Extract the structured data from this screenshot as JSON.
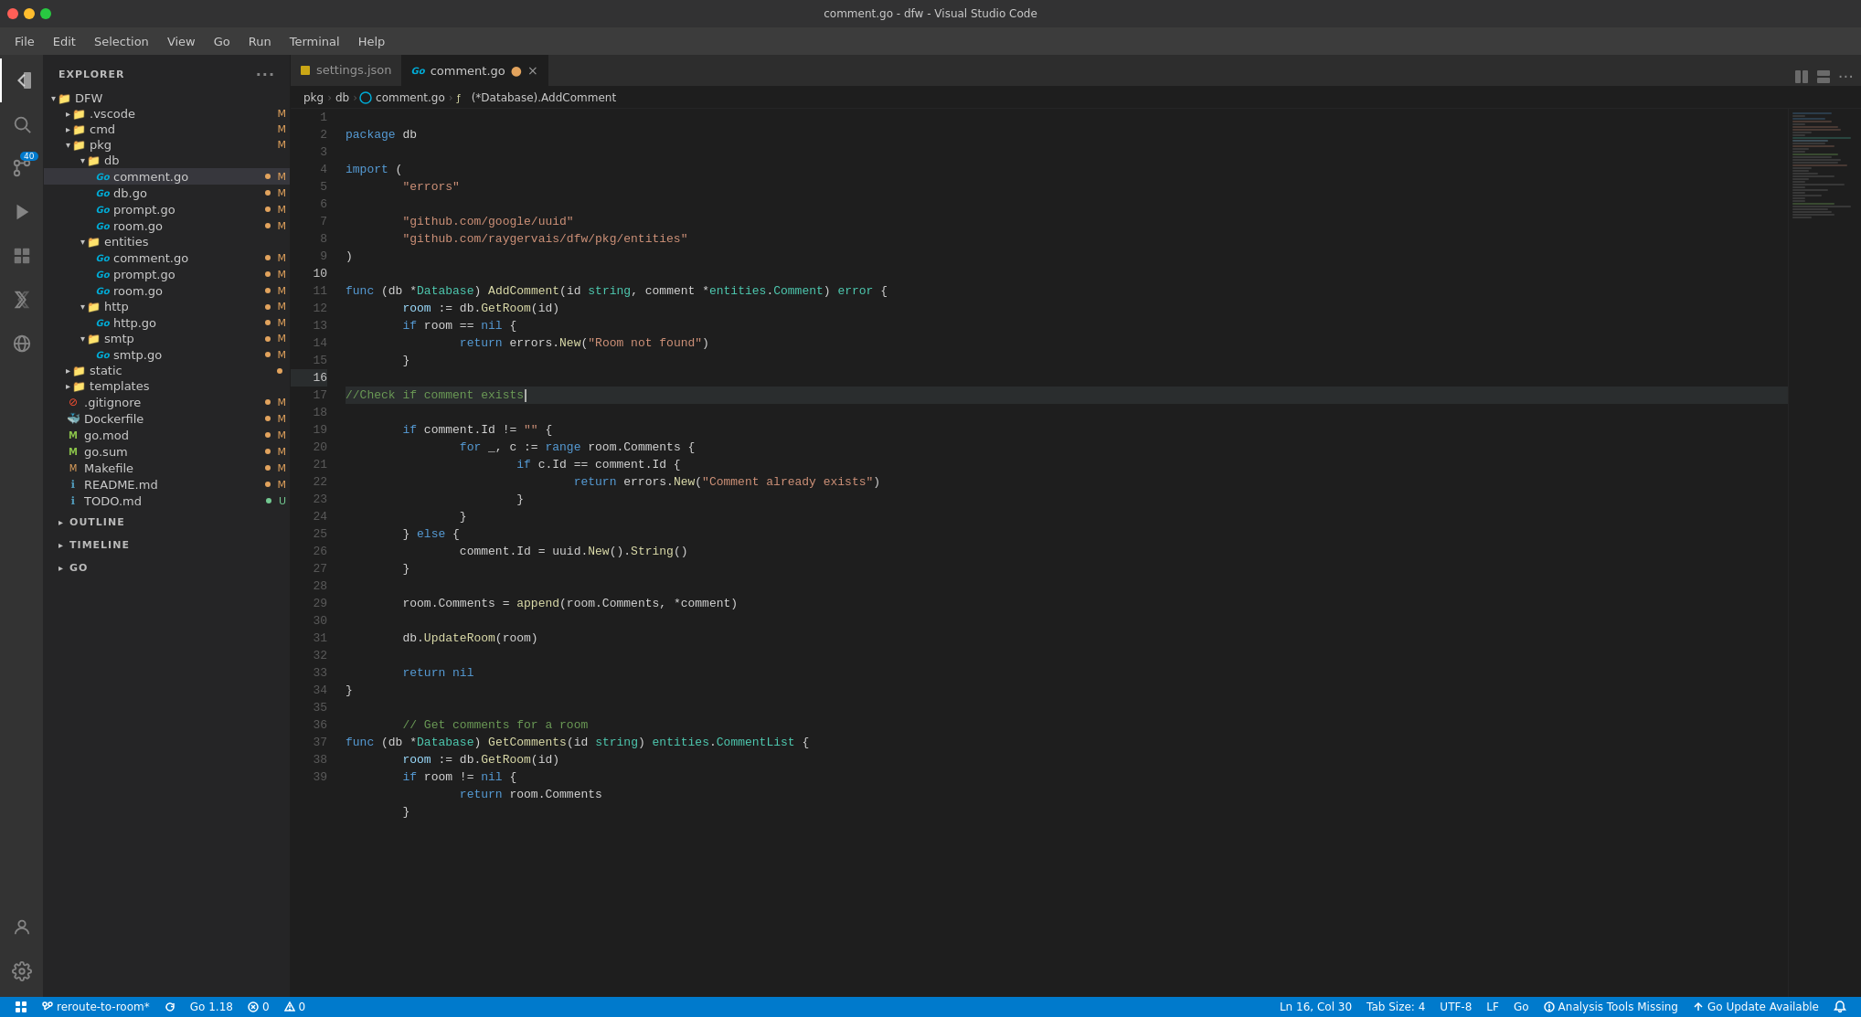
{
  "window": {
    "title": "comment.go - dfw - Visual Studio Code",
    "controls": {
      "close": "×",
      "minimize": "–",
      "maximize": "□"
    }
  },
  "menu": {
    "items": [
      "File",
      "Edit",
      "Selection",
      "View",
      "Go",
      "Run",
      "Terminal",
      "Help"
    ]
  },
  "sidebar": {
    "title": "EXPLORER",
    "root": "DFW",
    "tree": [
      {
        "label": ".vscode",
        "type": "folder",
        "indent": 1,
        "badge": "M",
        "expanded": false
      },
      {
        "label": "cmd",
        "type": "folder",
        "indent": 1,
        "badge": "M",
        "expanded": false
      },
      {
        "label": "pkg",
        "type": "folder",
        "indent": 1,
        "badge": "M",
        "expanded": true
      },
      {
        "label": "db",
        "type": "folder",
        "indent": 2,
        "badge": "",
        "expanded": true
      },
      {
        "label": "comment.go",
        "type": "file-go",
        "indent": 3,
        "badge": "M",
        "active": true
      },
      {
        "label": "db.go",
        "type": "file-go",
        "indent": 3,
        "badge": "M"
      },
      {
        "label": "prompt.go",
        "type": "file-go",
        "indent": 3,
        "badge": "M"
      },
      {
        "label": "room.go",
        "type": "file-go",
        "indent": 3,
        "badge": "M"
      },
      {
        "label": "entities",
        "type": "folder",
        "indent": 2,
        "badge": "",
        "expanded": true
      },
      {
        "label": "comment.go",
        "type": "file-go",
        "indent": 3,
        "badge": "M"
      },
      {
        "label": "prompt.go",
        "type": "file-go",
        "indent": 3,
        "badge": "M"
      },
      {
        "label": "room.go",
        "type": "file-go",
        "indent": 3,
        "badge": "M"
      },
      {
        "label": "http",
        "type": "folder",
        "indent": 2,
        "badge": "M",
        "expanded": true
      },
      {
        "label": "http.go",
        "type": "file-go",
        "indent": 3,
        "badge": "M"
      },
      {
        "label": "smtp",
        "type": "folder",
        "indent": 2,
        "badge": "M",
        "expanded": true
      },
      {
        "label": "smtp.go",
        "type": "file-go",
        "indent": 3,
        "badge": "M"
      },
      {
        "label": "static",
        "type": "folder",
        "indent": 1,
        "badge": "",
        "expanded": false
      },
      {
        "label": "templates",
        "type": "folder",
        "indent": 1,
        "badge": "",
        "expanded": false
      },
      {
        "label": ".gitignore",
        "type": "file-git",
        "indent": 1,
        "badge": "M"
      },
      {
        "label": "Dockerfile",
        "type": "file-docker",
        "indent": 1,
        "badge": "M"
      },
      {
        "label": "go.mod",
        "type": "file-mod",
        "indent": 1,
        "badge": "M"
      },
      {
        "label": "go.sum",
        "type": "file-mod",
        "indent": 1,
        "badge": "M"
      },
      {
        "label": "Makefile",
        "type": "file-make",
        "indent": 1,
        "badge": "M"
      },
      {
        "label": "README.md",
        "type": "file-md",
        "indent": 1,
        "badge": "M"
      },
      {
        "label": "TODO.md",
        "type": "file-md",
        "indent": 1,
        "badge": "U"
      }
    ],
    "outline": "OUTLINE",
    "timeline": "TIMELINE",
    "go_section": "GO"
  },
  "tabs": [
    {
      "label": "settings.json",
      "active": false,
      "modified": false,
      "icon": "json"
    },
    {
      "label": "comment.go",
      "active": true,
      "modified": true,
      "icon": "go"
    }
  ],
  "breadcrumb": {
    "items": [
      "pkg",
      "db",
      "comment.go",
      "(*Database).AddComment"
    ]
  },
  "code": {
    "lines": [
      {
        "n": 1,
        "text": "package db",
        "tokens": [
          {
            "t": "kw",
            "v": "package"
          },
          {
            "t": "",
            "v": " db"
          }
        ]
      },
      {
        "n": 2,
        "text": ""
      },
      {
        "n": 3,
        "text": "import (",
        "tokens": [
          {
            "t": "kw",
            "v": "import"
          },
          {
            "t": "",
            "v": " ("
          }
        ]
      },
      {
        "n": 4,
        "text": "\t\"errors\""
      },
      {
        "n": 5,
        "text": ""
      },
      {
        "n": 6,
        "text": "\t\"github.com/google/uuid\""
      },
      {
        "n": 7,
        "text": "\t\"github.com/raygervais/dfw/pkg/entities\""
      },
      {
        "n": 8,
        "text": ")"
      },
      {
        "n": 9,
        "text": ""
      },
      {
        "n": 10,
        "text": "func (db *Database) AddComment(id string, comment *entities.Comment) error {"
      },
      {
        "n": 11,
        "text": "\troom := db.GetRoom(id)"
      },
      {
        "n": 12,
        "text": "\tif room == nil {"
      },
      {
        "n": 13,
        "text": "\t\treturn errors.New(\"Room not found\")"
      },
      {
        "n": 14,
        "text": "\t}"
      },
      {
        "n": 15,
        "text": ""
      },
      {
        "n": 16,
        "text": "\t//Check if comment exists",
        "highlight": true,
        "active": true
      },
      {
        "n": 17,
        "text": "\tif comment.Id != \"\" {"
      },
      {
        "n": 18,
        "text": "\t\tfor _, c := range room.Comments {"
      },
      {
        "n": 19,
        "text": "\t\t\tif c.Id == comment.Id {"
      },
      {
        "n": 20,
        "text": "\t\t\t\treturn errors.New(\"Comment already exists\")"
      },
      {
        "n": 21,
        "text": "\t\t\t}"
      },
      {
        "n": 22,
        "text": "\t\t}"
      },
      {
        "n": 23,
        "text": "\t} else {"
      },
      {
        "n": 24,
        "text": "\t\tcomment.Id = uuid.New().String()"
      },
      {
        "n": 25,
        "text": "\t}"
      },
      {
        "n": 26,
        "text": ""
      },
      {
        "n": 27,
        "text": "\troom.Comments = append(room.Comments, *comment)"
      },
      {
        "n": 28,
        "text": ""
      },
      {
        "n": 29,
        "text": "\tdb.UpdateRoom(room)"
      },
      {
        "n": 30,
        "text": ""
      },
      {
        "n": 31,
        "text": "\treturn nil"
      },
      {
        "n": 32,
        "text": "}"
      },
      {
        "n": 33,
        "text": ""
      },
      {
        "n": 34,
        "text": "\t// Get comments for a room"
      },
      {
        "n": 35,
        "text": "func (db *Database) GetComments(id string) entities.CommentList {"
      },
      {
        "n": 36,
        "text": "\troom := db.GetRoom(id)"
      },
      {
        "n": 37,
        "text": "\tif room != nil {"
      },
      {
        "n": 38,
        "text": "\t\treturn room.Comments"
      },
      {
        "n": 39,
        "text": "\t}"
      }
    ]
  },
  "status": {
    "branch": "reroute-to-room*",
    "go_version": "Go 1.18",
    "errors": "0",
    "warnings": "0",
    "ln": "Ln 16, Col 30",
    "tab_size": "Tab Size: 4",
    "encoding": "UTF-8",
    "eol": "LF",
    "language": "Go",
    "analysis": "Analysis Tools Missing",
    "update": "Go Update Available",
    "remote_icon": "⊞",
    "bell_icon": "🔔",
    "error_icon": "⊘",
    "warning_icon": "⚠"
  },
  "activity": {
    "icons": [
      {
        "name": "explorer",
        "symbol": "⬜",
        "active": true
      },
      {
        "name": "search",
        "symbol": "🔍",
        "active": false
      },
      {
        "name": "source-control",
        "symbol": "⑂",
        "active": false,
        "badge": "40"
      },
      {
        "name": "run-debug",
        "symbol": "▷",
        "active": false
      },
      {
        "name": "extensions",
        "symbol": "⊞",
        "active": false
      },
      {
        "name": "testing",
        "symbol": "⚗",
        "active": false
      },
      {
        "name": "remote-explorer",
        "symbol": "◎",
        "active": false
      }
    ],
    "bottom": [
      {
        "name": "accounts",
        "symbol": "👤"
      },
      {
        "name": "settings",
        "symbol": "⚙"
      }
    ]
  }
}
